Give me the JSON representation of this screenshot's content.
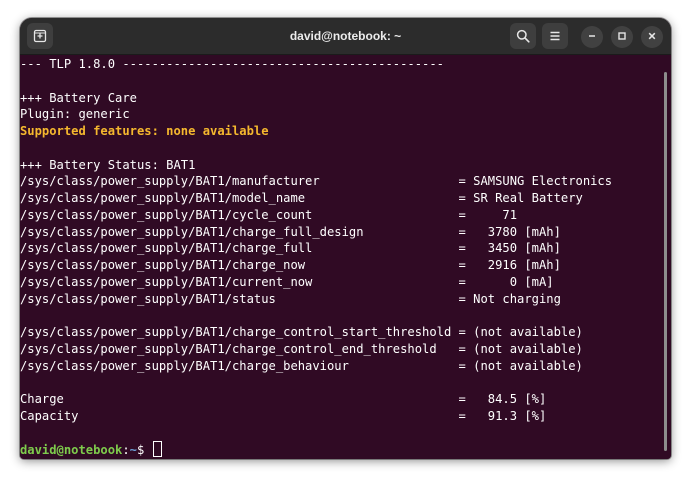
{
  "window": {
    "title": "david@notebook: ~"
  },
  "titlebar_icons": {
    "new_tab": "new-tab-icon",
    "search": "search-icon",
    "menu": "hamburger-menu-icon",
    "minimize": "minimize-icon",
    "maximize": "maximize-icon",
    "close": "close-icon"
  },
  "terminal": {
    "lines": [
      "--- TLP 1.8.0 --------------------------------------------",
      "",
      "+++ Battery Care",
      "Plugin: generic",
      "Supported features: none available",
      "",
      "+++ Battery Status: BAT1",
      "/sys/class/power_supply/BAT1/manufacturer                   = SAMSUNG Electronics",
      "/sys/class/power_supply/BAT1/model_name                     = SR Real Battery",
      "/sys/class/power_supply/BAT1/cycle_count                    =     71",
      "/sys/class/power_supply/BAT1/charge_full_design             =   3780 [mAh]",
      "/sys/class/power_supply/BAT1/charge_full                    =   3450 [mAh]",
      "/sys/class/power_supply/BAT1/charge_now                     =   2916 [mAh]",
      "/sys/class/power_supply/BAT1/current_now                    =      0 [mA]",
      "/sys/class/power_supply/BAT1/status                         = Not charging",
      "",
      "/sys/class/power_supply/BAT1/charge_control_start_threshold = (not available)",
      "/sys/class/power_supply/BAT1/charge_control_end_threshold   = (not available)",
      "/sys/class/power_supply/BAT1/charge_behaviour               = (not available)",
      "",
      "Charge                                                      =   84.5 [%]",
      "Capacity                                                    =   91.3 [%]",
      ""
    ],
    "highlight_line_index": 4,
    "prompt": {
      "user_host": "david@notebook",
      "separator": ":",
      "path": "~",
      "symbol": "$ "
    }
  },
  "colors": {
    "terminal_bg": "#300a24",
    "titlebar_bg": "#2c2c2c",
    "text": "#ffffff",
    "warning": "#f5b82e",
    "prompt_user": "#7ecb4c",
    "prompt_path": "#6d9fd6"
  }
}
